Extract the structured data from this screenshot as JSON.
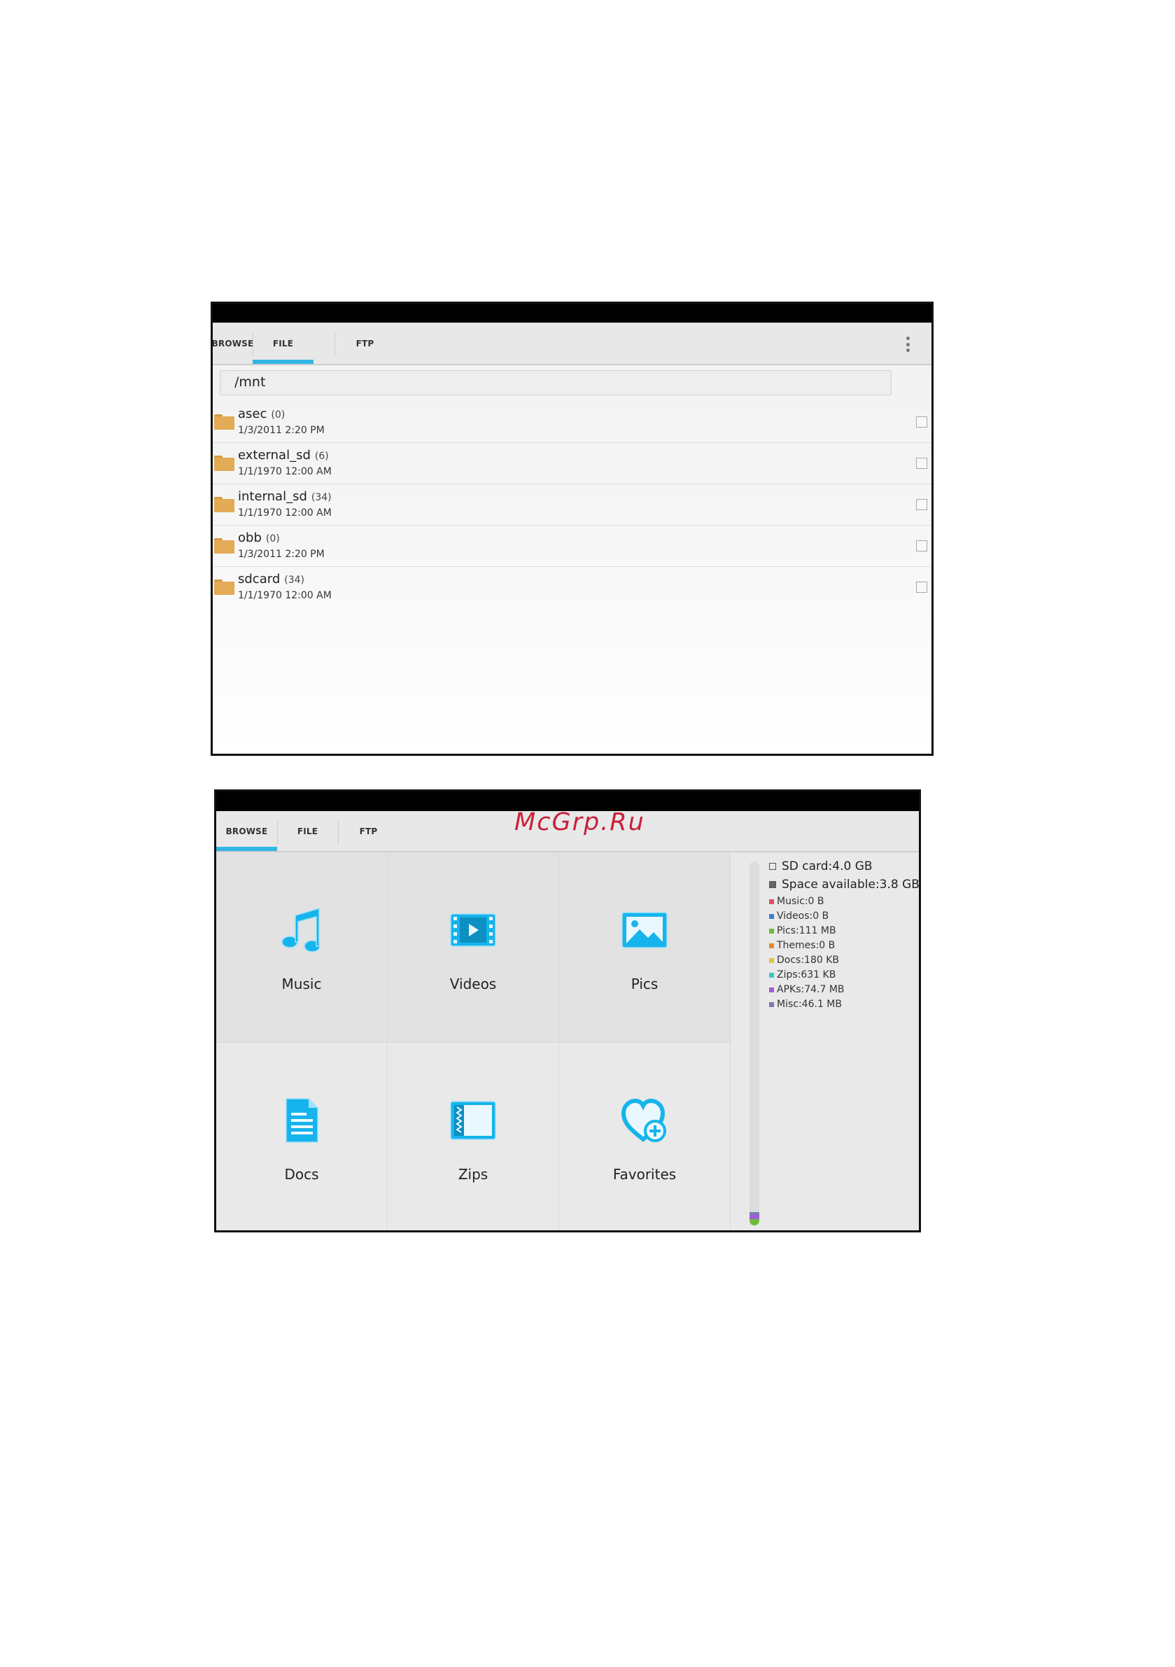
{
  "watermark": "McGrp.Ru",
  "colors": {
    "accent": "#33b5e5",
    "folder": "#e3ab55",
    "icon_blue": "#16b4ec"
  },
  "file_screen": {
    "tabs": [
      {
        "label": "BROWSE",
        "active": false
      },
      {
        "label": "FILE",
        "active": true
      },
      {
        "label": "FTP",
        "active": false
      }
    ],
    "path": "/mnt",
    "items": [
      {
        "name": "asec",
        "count": "(0)",
        "date": "1/3/2011 2:20 PM"
      },
      {
        "name": "external_sd",
        "count": "(6)",
        "date": "1/1/1970 12:00 AM"
      },
      {
        "name": "internal_sd",
        "count": "(34)",
        "date": "1/1/1970 12:00 AM"
      },
      {
        "name": "obb",
        "count": "(0)",
        "date": "1/3/2011 2:20 PM"
      },
      {
        "name": "sdcard",
        "count": "(34)",
        "date": "1/1/1970 12:00 AM"
      }
    ]
  },
  "browse_screen": {
    "tabs": [
      {
        "label": "BROWSE",
        "active": true
      },
      {
        "label": "FILE",
        "active": false
      },
      {
        "label": "FTP",
        "active": false
      }
    ],
    "tiles": [
      {
        "label": "Music",
        "icon": "music-icon"
      },
      {
        "label": "Videos",
        "icon": "video-icon"
      },
      {
        "label": "Pics",
        "icon": "picture-icon"
      },
      {
        "label": "Docs",
        "icon": "document-icon"
      },
      {
        "label": "Zips",
        "icon": "zip-icon"
      },
      {
        "label": "Favorites",
        "icon": "favorites-icon"
      }
    ],
    "storage": {
      "sd_card": "SD card:4.0 GB",
      "space_available": "Space available:3.8 GB",
      "categories": [
        {
          "label": "Music:0 B",
          "color": "#e0506a"
        },
        {
          "label": "Videos:0 B",
          "color": "#3a7fd0"
        },
        {
          "label": "Pics:111 MB",
          "color": "#6cbc3a"
        },
        {
          "label": "Themes:0 B",
          "color": "#e08a2a"
        },
        {
          "label": "Docs:180 KB",
          "color": "#e2c340"
        },
        {
          "label": "Zips:631 KB",
          "color": "#3ec6c6"
        },
        {
          "label": "APKs:74.7 MB",
          "color": "#a25ad6"
        },
        {
          "label": "Misc:46.1 MB",
          "color": "#7a7ab8"
        }
      ]
    }
  }
}
